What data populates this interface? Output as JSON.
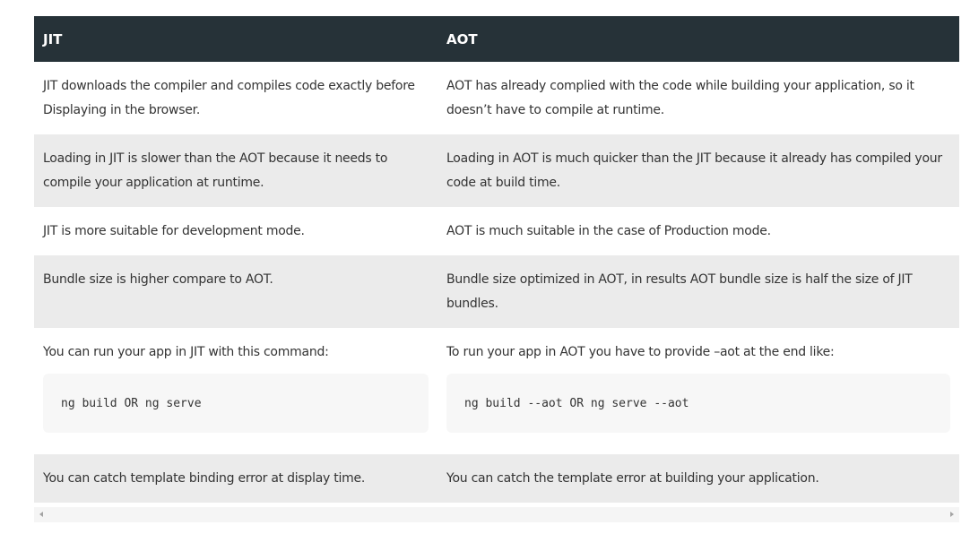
{
  "table": {
    "headers": [
      "JIT",
      "AOT"
    ],
    "rows": [
      {
        "jit": "JIT downloads the compiler and compiles code exactly before Displaying in the browser.",
        "aot": "AOT has already complied with the code while building your application, so it doesn’t have to compile at runtime."
      },
      {
        "jit": "Loading in JIT is slower than the AOT because it needs to compile your application at runtime.",
        "aot": "Loading in AOT is much quicker than the JIT because it already has compiled your code at build time."
      },
      {
        "jit": "JIT is more suitable for development mode.",
        "aot": "AOT is much suitable in the case of Production mode."
      },
      {
        "jit": "Bundle size is higher compare to AOT.",
        "aot": "Bundle size optimized in AOT, in results AOT bundle size is half the size of JIT bundles."
      },
      {
        "jit": "You can run your app in JIT with this command:",
        "jit_code": "ng build OR ng serve",
        "aot": "To run your app in AOT you have to provide –aot at the end like:",
        "aot_code": "ng build --aot OR ng serve --aot"
      },
      {
        "jit": "You can catch template binding error at display time.",
        "aot": "You can catch the template error at building your application."
      }
    ]
  },
  "colors": {
    "header_bg": "#263238",
    "header_text": "#ffffff",
    "stripe_bg": "#ebebeb",
    "code_bg": "#f7f7f7"
  },
  "icons": [
    "scroll-left-arrow-icon",
    "scroll-right-arrow-icon"
  ]
}
